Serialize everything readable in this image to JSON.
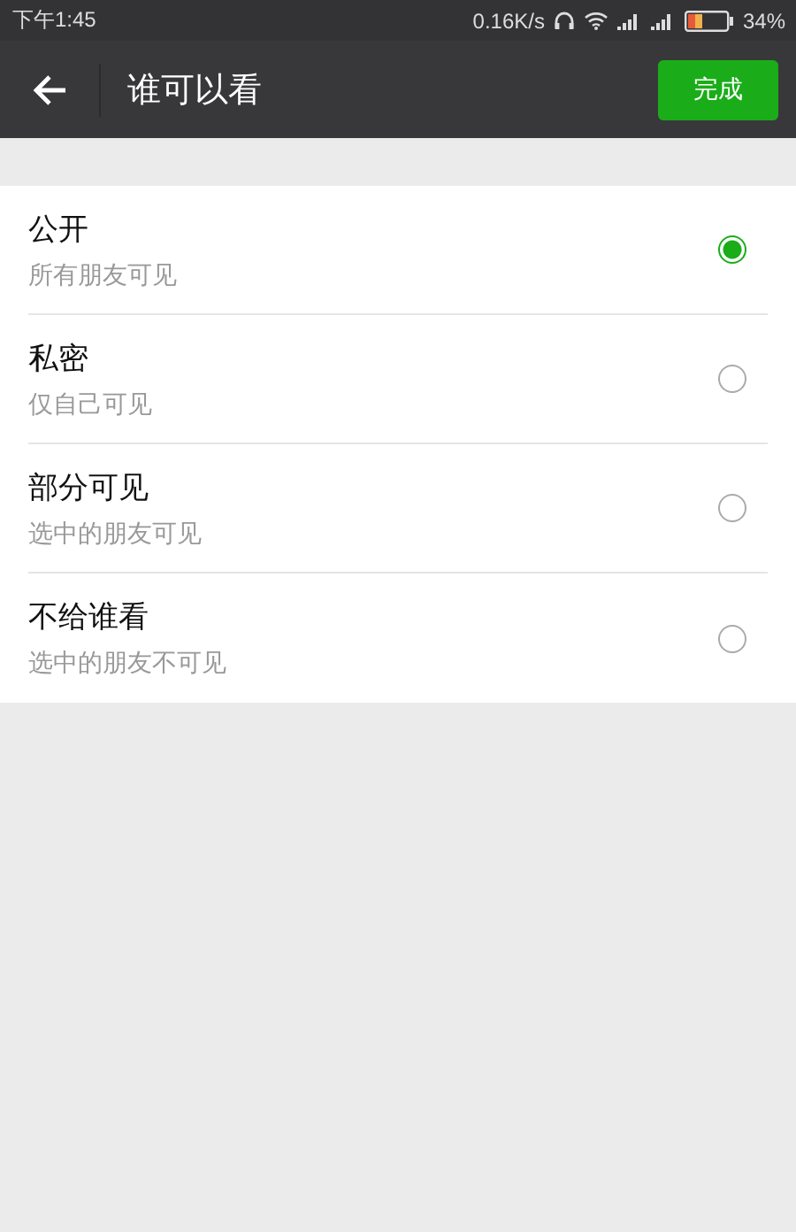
{
  "status_bar": {
    "time": "下午1:45",
    "speed": "0.16K/s",
    "battery": "34%"
  },
  "header": {
    "title": "谁可以看",
    "done_button": "完成"
  },
  "options": [
    {
      "title": "公开",
      "subtitle": "所有朋友可见",
      "selected": true
    },
    {
      "title": "私密",
      "subtitle": "仅自己可见",
      "selected": false
    },
    {
      "title": "部分可见",
      "subtitle": "选中的朋友可见",
      "selected": false
    },
    {
      "title": "不给谁看",
      "subtitle": "选中的朋友不可见",
      "selected": false
    }
  ]
}
